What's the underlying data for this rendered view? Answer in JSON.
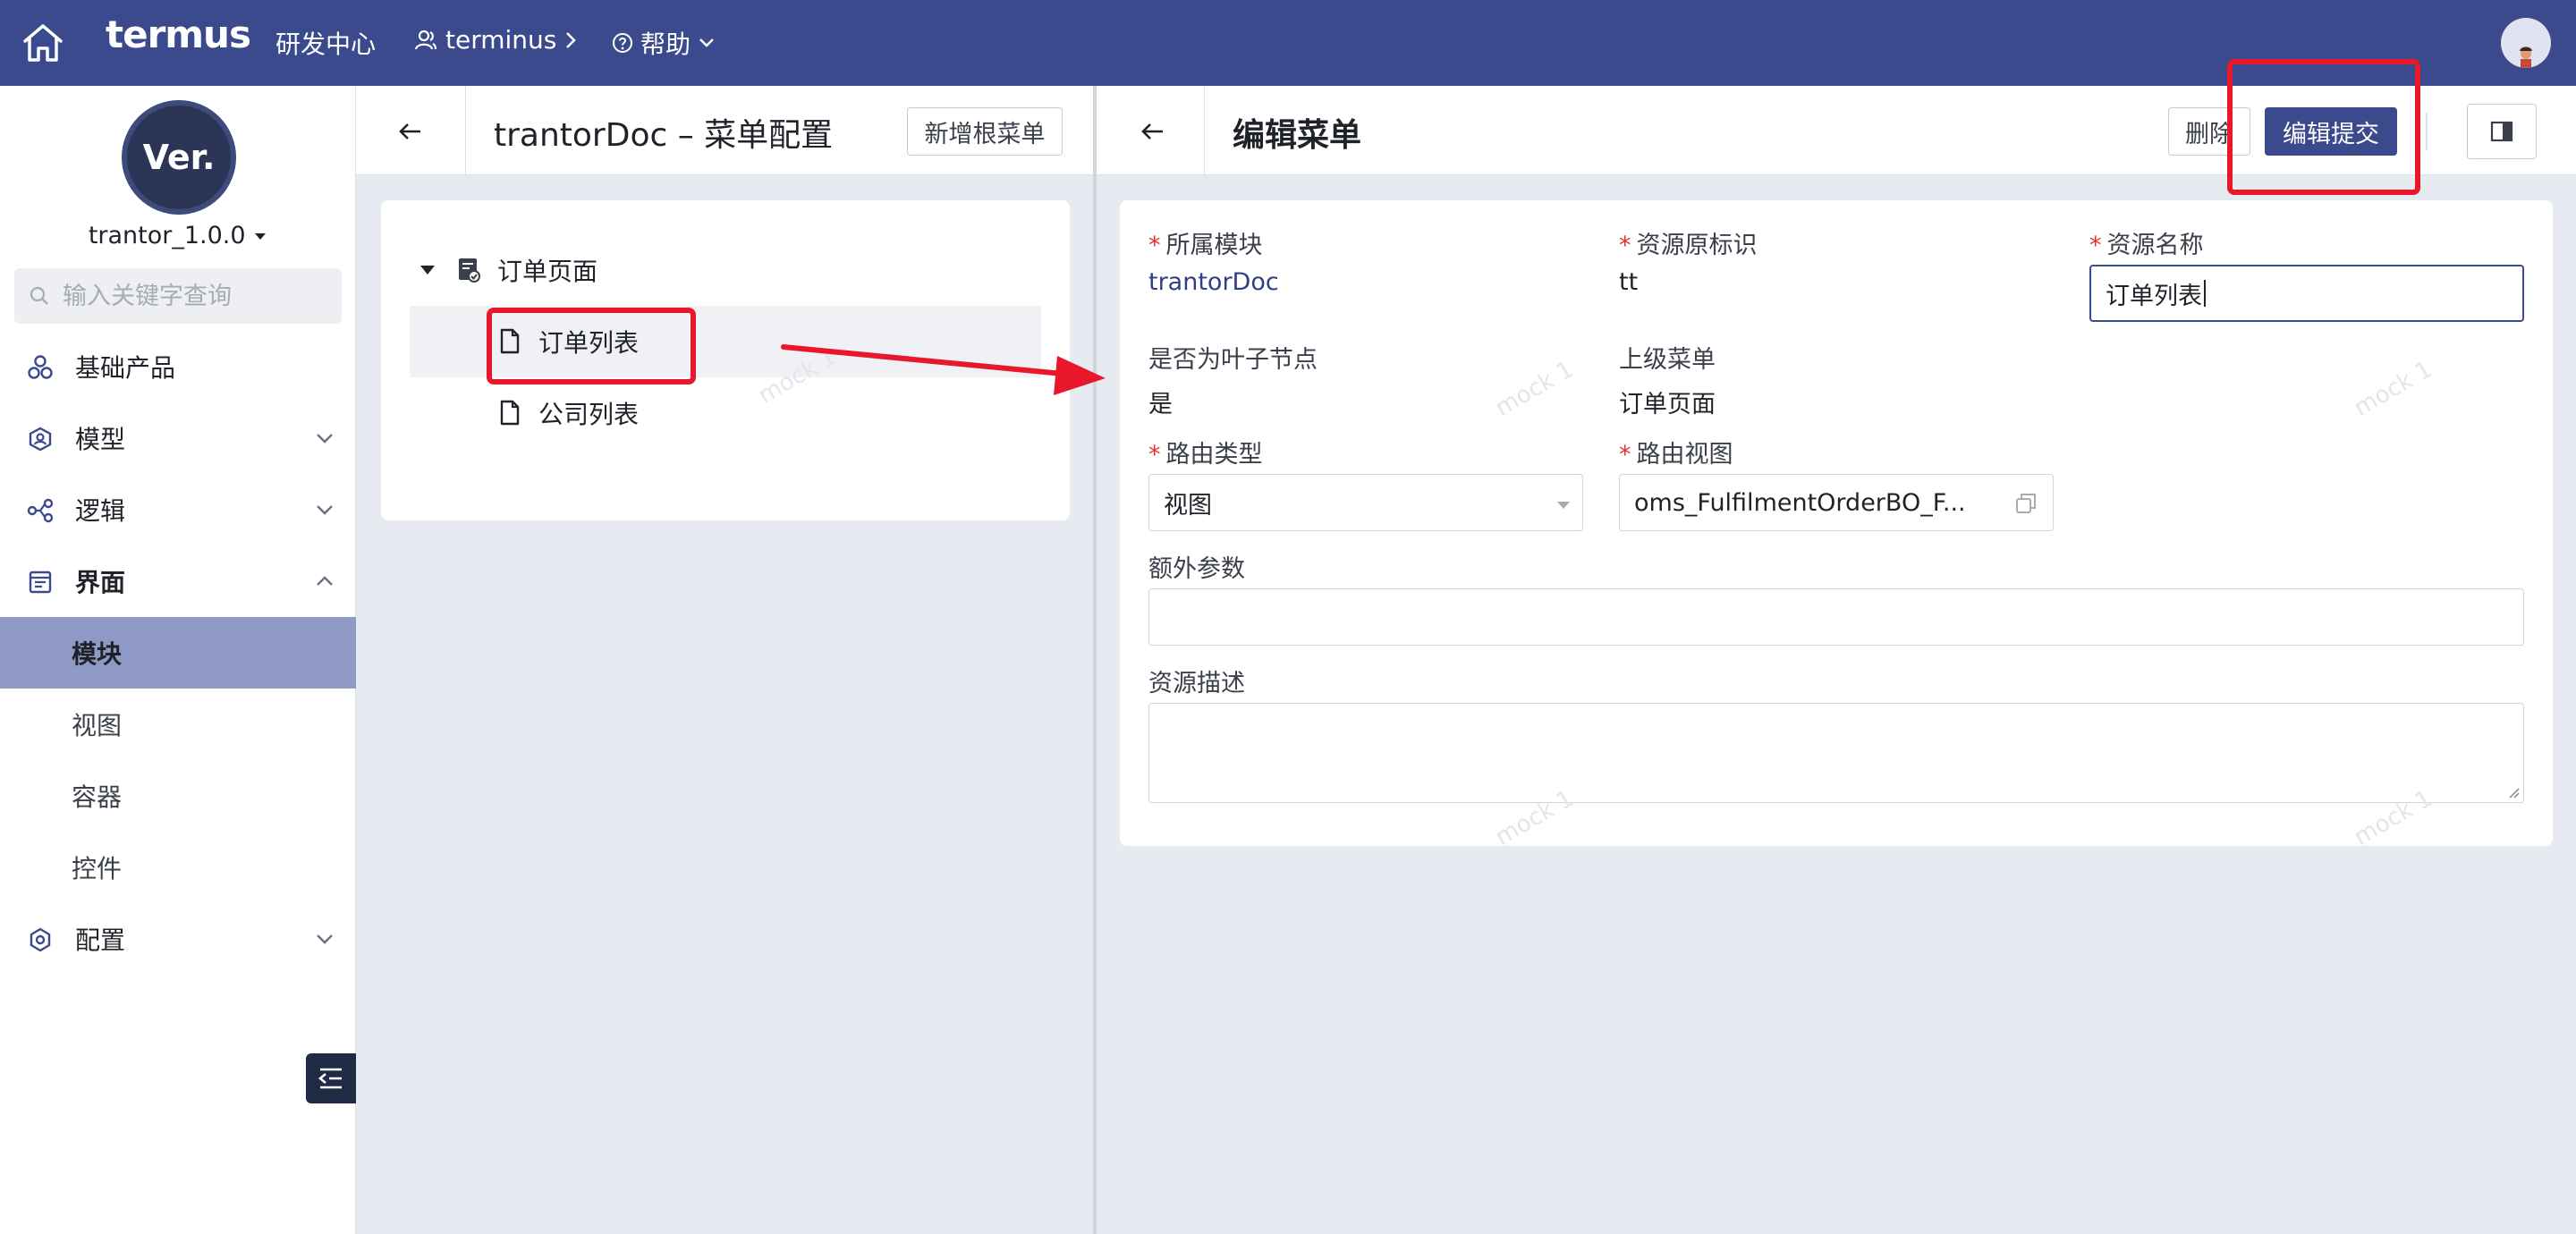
{
  "topbar": {
    "logo": "termus",
    "section": "研发中心",
    "workspace": "terminus",
    "help": "帮助",
    "icons": [
      "home-icon",
      "user-group-icon",
      "chevron-right-icon",
      "help-circle-icon",
      "chevron-down-icon",
      "avatar"
    ]
  },
  "sidebar": {
    "badge": "Ver.",
    "version": "trantor_1.0.0",
    "search_placeholder": "输入关键字查询",
    "items": [
      {
        "label": "基础产品",
        "icon": "cluster-icon"
      },
      {
        "label": "模型",
        "icon": "model-icon"
      },
      {
        "label": "逻辑",
        "icon": "logic-icon"
      },
      {
        "label": "界面",
        "icon": "layout-icon"
      },
      {
        "label": "配置",
        "icon": "settings-icon"
      }
    ],
    "sub_items": [
      {
        "label": "模块",
        "active": true
      },
      {
        "label": "视图",
        "active": false
      },
      {
        "label": "容器",
        "active": false
      },
      {
        "label": "控件",
        "active": false
      }
    ]
  },
  "middle": {
    "title": "trantorDoc – 菜单配置",
    "add_root_button": "新增根菜单",
    "tree": {
      "root": "订单页面",
      "children": [
        "订单列表",
        "公司列表"
      ],
      "selected": "订单列表"
    }
  },
  "right": {
    "title": "编辑菜单",
    "delete_button": "删除",
    "submit_button": "编辑提交",
    "form": {
      "module_label": "所属模块",
      "module_value": "trantorDoc",
      "resource_key_label": "资源原标识",
      "resource_key_value": "tt",
      "resource_name_label": "资源名称",
      "resource_name_value": "订单列表",
      "is_leaf_label": "是否为叶子节点",
      "is_leaf_value": "是",
      "parent_label": "上级菜单",
      "parent_value": "订单页面",
      "route_type_label": "路由类型",
      "route_type_value": "视图",
      "route_view_label": "路由视图",
      "route_view_value": "oms_FulfilmentOrderBO_F...",
      "extra_params_label": "额外参数",
      "extra_params_value": "",
      "description_label": "资源描述",
      "description_value": ""
    },
    "watermark": "mock 1"
  },
  "colors": {
    "topbar": "#3a4a8c",
    "primary": "#3a4a8c",
    "active_nav": "#8f99c6",
    "required": "#e5322d",
    "annotation": "#e8182a"
  }
}
